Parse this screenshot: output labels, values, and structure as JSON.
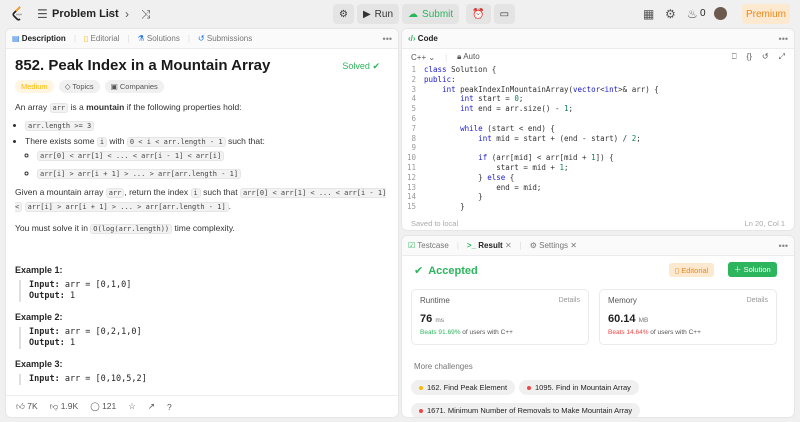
{
  "topbar": {
    "title": "Problem List",
    "run_label": "Run",
    "submit_label": "Submit",
    "coin_count": "0",
    "premium_label": "Premium"
  },
  "description": {
    "tabs": [
      "Description",
      "Editorial",
      "Solutions",
      "Submissions"
    ],
    "title": "852. Peak Index in a Mountain Array",
    "solved_label": "Solved",
    "tags": [
      "Medium",
      "Topics",
      "Companies"
    ],
    "intro_a": "An array ",
    "intro_arr": "arr",
    "intro_b": " is a ",
    "intro_mountain": "mountain",
    "intro_c": " if the following properties hold:",
    "bullet1": "arr.length >= 3",
    "bullet2_a": "There exists some ",
    "bullet2_i": "i",
    "bullet2_b": " with ",
    "bullet2_range": "0 < i < arr.length - 1",
    "bullet2_c": " such that:",
    "sub1": "arr[0] < arr[1] < ... < arr[i - 1] < arr[i]",
    "sub2": "arr[i] > arr[i + 1] > ... > arr[arr.length - 1]",
    "given_a": "Given a mountain array ",
    "given_arr": "arr",
    "given_b": ", return the index ",
    "given_i": "i",
    "given_c": " such that ",
    "given_code1": "arr[0] < arr[1] < ... < arr[i - 1] <",
    "given_code2": "arr[i] > arr[i + 1] > ... > arr[arr.length - 1]",
    "given_d": ".",
    "solve_a": "You must solve it in ",
    "solve_code": "O(log(arr.length))",
    "solve_b": " time complexity.",
    "examples": [
      {
        "title": "Example 1:",
        "input_label": "Input:",
        "input": " arr = [0,1,0]",
        "output_label": "Output:",
        "output": " 1"
      },
      {
        "title": "Example 2:",
        "input_label": "Input:",
        "input": " arr = [0,2,1,0]",
        "output_label": "Output:",
        "output": " 1"
      },
      {
        "title": "Example 3:",
        "input_label": "Input:",
        "input": " arr = [0,10,5,2]",
        "output_label": "",
        "output": ""
      }
    ],
    "likes": "7K",
    "dislikes": "1.9K",
    "comments": "121"
  },
  "code": {
    "tab_label": "Code",
    "language": "C++",
    "mode": "Auto",
    "saved": "Saved to local",
    "cursor": "Ln 20, Col 1",
    "lines": [
      "class Solution {",
      "public:",
      "    int peakIndexInMountainArray(vector<int>& arr) {",
      "        int start = 0;",
      "        int end = arr.size() - 1;",
      "",
      "        while (start < end) {",
      "            int mid = start + (end - start) / 2;",
      "",
      "            if (arr[mid] < arr[mid + 1]) {",
      "                start = mid + 1;",
      "            } else {",
      "                end = mid;",
      "            }",
      "        }"
    ],
    "line_numbers": [
      "1",
      "2",
      "3",
      "4",
      "5",
      "6",
      "7",
      "8",
      "9",
      "10",
      "11",
      "12",
      "13",
      "14",
      "15"
    ]
  },
  "result": {
    "tabs": [
      "Testcase",
      "Result",
      "Settings"
    ],
    "status": "Accepted",
    "editorial_label": "Editorial",
    "solution_label": "Solution",
    "runtime": {
      "label": "Runtime",
      "details": "Details",
      "value": "76",
      "unit": "ms",
      "beats": "Beats 91.69%",
      "beats_suffix": " of users with C++"
    },
    "memory": {
      "label": "Memory",
      "details": "Details",
      "value": "60.14",
      "unit": "MB",
      "beats": "Beats 14.64%",
      "beats_suffix": " of users with C++"
    },
    "more_title": "More challenges",
    "challenges": [
      {
        "label": "162. Find Peak Element",
        "color": "#ffb800"
      },
      {
        "label": "1095. Find in Mountain Array",
        "color": "#ef4743"
      },
      {
        "label": "1671. Minimum Number of Removals to Make Mountain Array",
        "color": "#ef4743"
      }
    ]
  },
  "colors": {
    "accent_green": "#2db55d",
    "accent_orange": "#e8891c",
    "medium": "#ffb800",
    "hard": "#ef4743"
  }
}
